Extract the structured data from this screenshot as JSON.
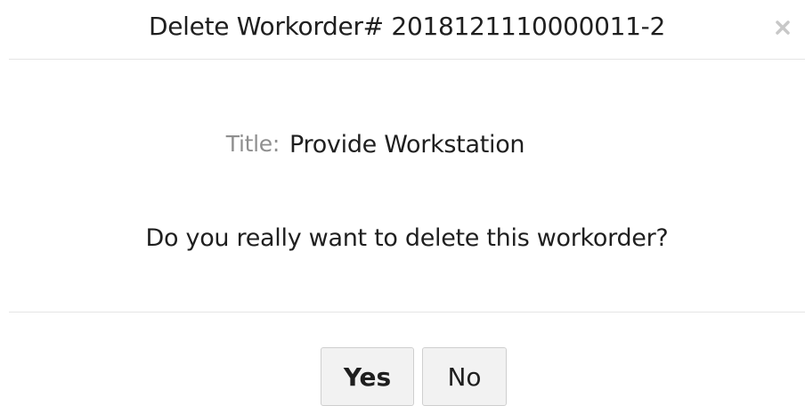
{
  "dialog": {
    "title": "Delete Workorder# 2018121110000011-2",
    "close_icon": "close-icon"
  },
  "content": {
    "field_label": "Title:",
    "field_value": "Provide Workstation",
    "question": "Do you really want to delete this workorder?"
  },
  "buttons": {
    "yes_label": "Yes",
    "no_label": "No"
  },
  "colors": {
    "text": "#1f1f1f",
    "label": "#8f8f8f",
    "divider": "#e5e5e5",
    "button_bg": "#f2f2f2",
    "button_border": "#cfcfcf"
  }
}
